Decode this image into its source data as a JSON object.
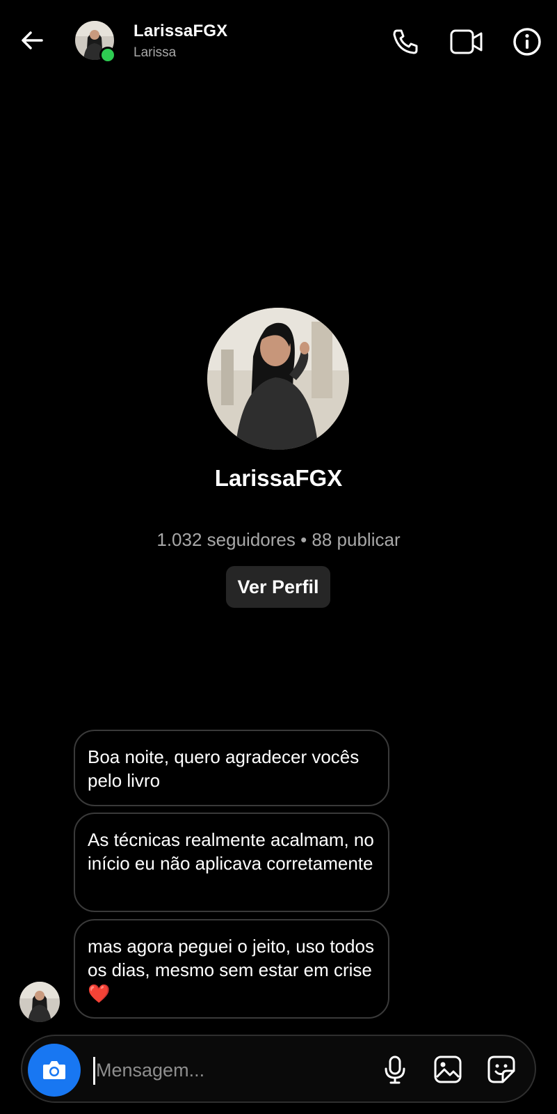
{
  "header": {
    "name": "LarissaFGX",
    "subtitle": "Larissa",
    "icons": [
      "back-arrow-icon",
      "phone-icon",
      "video-camera-icon",
      "info-icon"
    ],
    "online": true
  },
  "profile": {
    "name": "LarissaFGX",
    "stats": "1.032 seguidores • 88 publicar",
    "view_profile_label": "Ver Perfil"
  },
  "messages": [
    {
      "text": "Boa noite, quero agradecer vocês pelo livro"
    },
    {
      "text": "As técnicas realmente acalmam, no início eu não aplicava corretamente"
    },
    {
      "text": "mas agora peguei o jeito, uso todos os dias, mesmo sem estar em crise",
      "emoji": "❤️"
    }
  ],
  "composer": {
    "placeholder": "Mensagem...",
    "icons": [
      "camera-icon",
      "microphone-icon",
      "gallery-icon",
      "sticker-icon"
    ]
  },
  "colors": {
    "background": "#000000",
    "accent_blue": "#1877f2",
    "online_green": "#2ecc52",
    "secondary_text": "#a8a8a8",
    "bubble_border": "#3a3a3a",
    "button_bg": "#262626"
  }
}
